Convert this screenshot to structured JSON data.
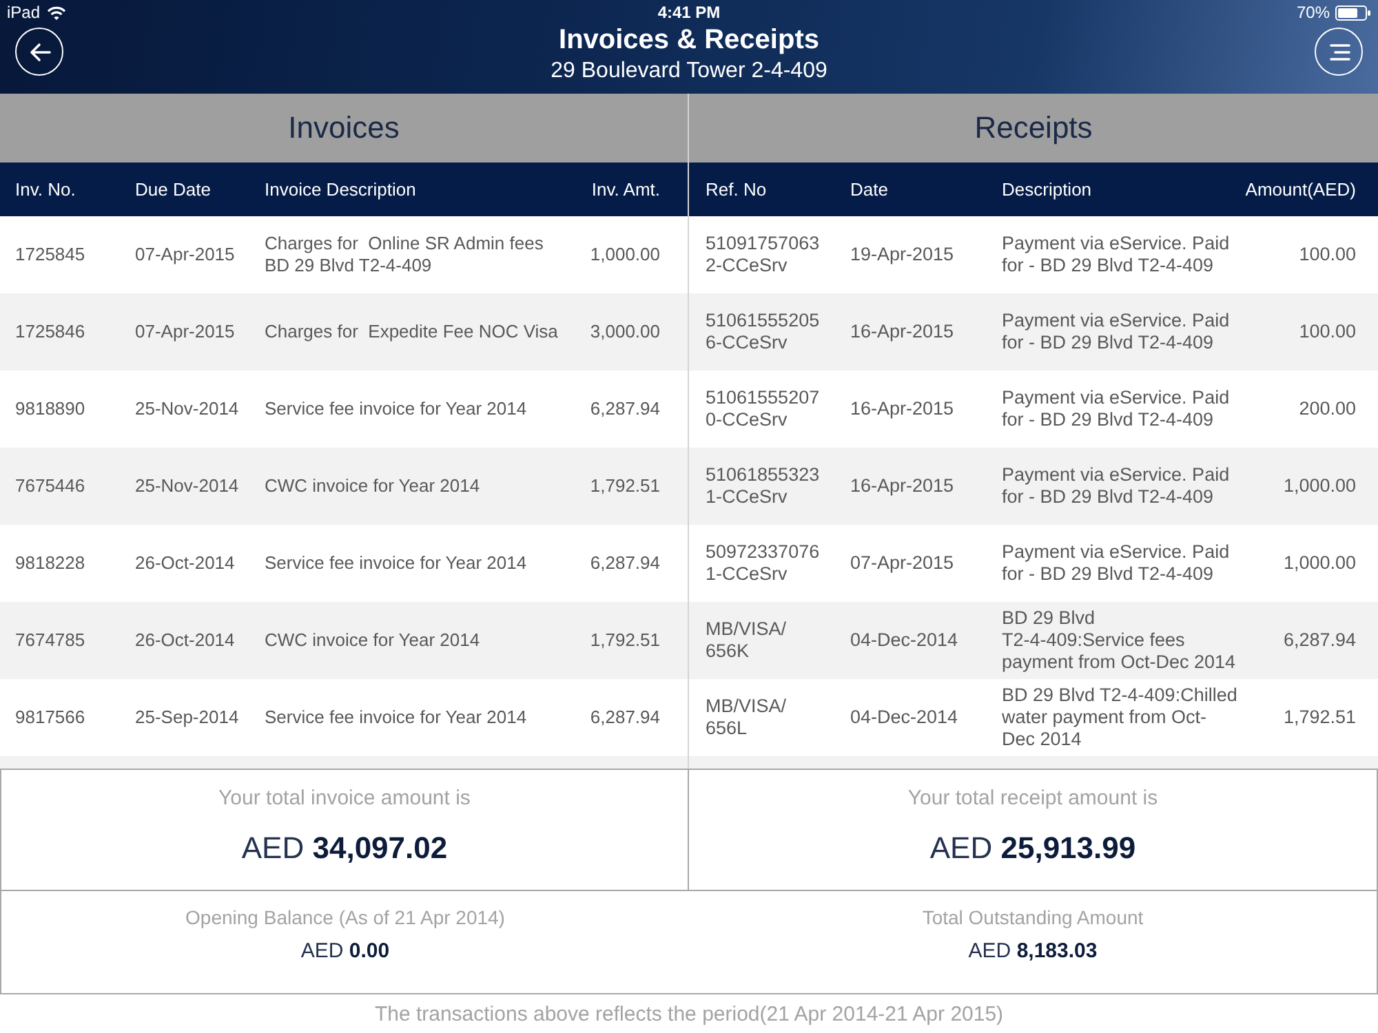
{
  "status_bar": {
    "device": "iPad",
    "time": "4:41 PM",
    "battery": "70%"
  },
  "header": {
    "title": "Invoices & Receipts",
    "subtitle": "29 Boulevard Tower 2-4-409"
  },
  "invoices": {
    "title": "Invoices",
    "columns": [
      "Inv. No.",
      "Due Date",
      "Invoice Description",
      "Inv. Amt."
    ],
    "rows": [
      [
        "1725845",
        "07-Apr-2015",
        "Charges for  Online SR Admin fees\nBD 29 Blvd T2-4-409",
        "1,000.00"
      ],
      [
        "1725846",
        "07-Apr-2015",
        "Charges for  Expedite Fee NOC Visa",
        "3,000.00"
      ],
      [
        "9818890",
        "25-Nov-2014",
        "Service fee invoice for Year 2014",
        "6,287.94"
      ],
      [
        "7675446",
        "25-Nov-2014",
        "CWC invoice for Year 2014",
        "1,792.51"
      ],
      [
        "9818228",
        "26-Oct-2014",
        "Service fee invoice for Year 2014",
        "6,287.94"
      ],
      [
        "7674785",
        "26-Oct-2014",
        "CWC invoice for Year 2014",
        "1,792.51"
      ],
      [
        "9817566",
        "25-Sep-2014",
        "Service fee invoice for Year 2014",
        "6,287.94"
      ]
    ]
  },
  "receipts": {
    "title": "Receipts",
    "columns": [
      "Ref. No",
      "Date",
      "Description",
      "Amount(AED)"
    ],
    "rows": [
      [
        "51091757063\n2-CCeSrv",
        "19-Apr-2015",
        "Payment via eService. Paid\nfor - BD 29 Blvd T2-4-409",
        "100.00"
      ],
      [
        "51061555205\n6-CCeSrv",
        "16-Apr-2015",
        "Payment via eService. Paid\nfor - BD 29 Blvd T2-4-409",
        "100.00"
      ],
      [
        "51061555207\n0-CCeSrv",
        "16-Apr-2015",
        "Payment via eService. Paid\nfor - BD 29 Blvd T2-4-409",
        "200.00"
      ],
      [
        "51061855323\n1-CCeSrv",
        "16-Apr-2015",
        "Payment via eService. Paid\nfor - BD 29 Blvd T2-4-409",
        "1,000.00"
      ],
      [
        "50972337076\n1-CCeSrv",
        "07-Apr-2015",
        "Payment via eService. Paid\nfor - BD 29 Blvd T2-4-409",
        "1,000.00"
      ],
      [
        "MB/VISA/\n656K",
        "04-Dec-2014",
        "BD 29 Blvd\nT2-4-409:Service fees\npayment from Oct-Dec 2014",
        "6,287.94"
      ],
      [
        "MB/VISA/\n656L",
        "04-Dec-2014",
        "BD 29 Blvd T2-4-409:Chilled\nwater payment from Oct-\nDec 2014",
        "1,792.51"
      ]
    ]
  },
  "totals": [
    {
      "label": "Your total invoice amount is",
      "amount": "AED **34,097.02**"
    },
    {
      "label": "Your total receipt amount is",
      "amount": "AED **25,913.99**"
    }
  ],
  "balances": [
    {
      "label": "Opening Balance (As of 21 Apr 2014)",
      "amount": "AED **0.00**"
    },
    {
      "label": "Total Outstanding Amount",
      "amount": "AED **8,183.03**"
    }
  ],
  "footer": "The transactions above reflects the period(21 Apr 2014-21 Apr 2015)"
}
